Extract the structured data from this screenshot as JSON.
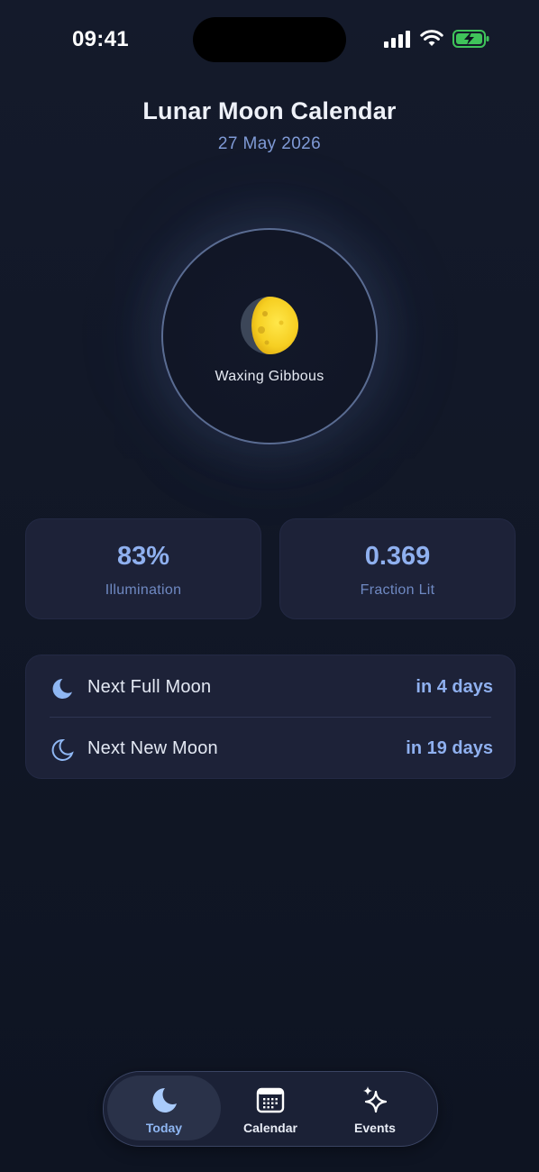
{
  "status_bar": {
    "time": "09:41"
  },
  "header": {
    "title": "Lunar Moon Calendar",
    "date": "27 May 2026"
  },
  "moon": {
    "icon": "waxing-gibbous-moon-icon",
    "phase_name": "Waxing Gibbous"
  },
  "stats": [
    {
      "value": "83%",
      "label": "Illumination"
    },
    {
      "value": "0.369",
      "label": "Fraction Lit"
    }
  ],
  "next_events": [
    {
      "icon": "full-moon-crescent-icon",
      "label": "Next Full Moon",
      "value": "in 4 days"
    },
    {
      "icon": "new-moon-crescent-icon",
      "label": "Next New Moon",
      "value": "in 19 days"
    }
  ],
  "tabs": [
    {
      "label": "Today",
      "icon": "moon-icon",
      "selected": true
    },
    {
      "label": "Calendar",
      "icon": "calendar-icon",
      "selected": false
    },
    {
      "label": "Events",
      "icon": "sparkles-icon",
      "selected": false
    }
  ],
  "colors": {
    "background": "#121829",
    "accent": "#8fb0ef",
    "card": "#1d2238",
    "moon_yellow": "#f7d632",
    "battery_green": "#3fc35a"
  }
}
